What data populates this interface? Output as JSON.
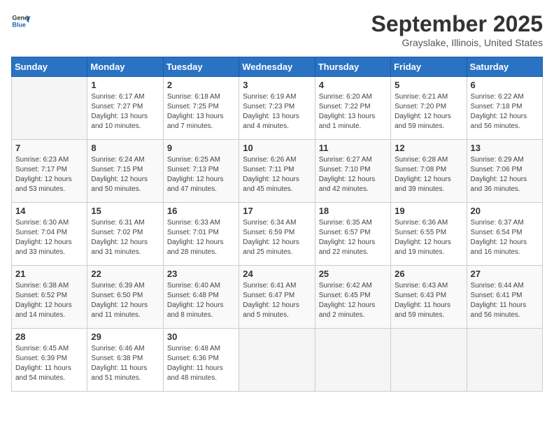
{
  "logo": {
    "line1": "General",
    "line2": "Blue"
  },
  "title": "September 2025",
  "location": "Grayslake, Illinois, United States",
  "days_of_week": [
    "Sunday",
    "Monday",
    "Tuesday",
    "Wednesday",
    "Thursday",
    "Friday",
    "Saturday"
  ],
  "weeks": [
    [
      null,
      {
        "day": "1",
        "sunrise": "6:17 AM",
        "sunset": "7:27 PM",
        "daylight": "13 hours and 10 minutes."
      },
      {
        "day": "2",
        "sunrise": "6:18 AM",
        "sunset": "7:25 PM",
        "daylight": "13 hours and 7 minutes."
      },
      {
        "day": "3",
        "sunrise": "6:19 AM",
        "sunset": "7:23 PM",
        "daylight": "13 hours and 4 minutes."
      },
      {
        "day": "4",
        "sunrise": "6:20 AM",
        "sunset": "7:22 PM",
        "daylight": "13 hours and 1 minute."
      },
      {
        "day": "5",
        "sunrise": "6:21 AM",
        "sunset": "7:20 PM",
        "daylight": "12 hours and 59 minutes."
      },
      {
        "day": "6",
        "sunrise": "6:22 AM",
        "sunset": "7:18 PM",
        "daylight": "12 hours and 56 minutes."
      }
    ],
    [
      {
        "day": "7",
        "sunrise": "6:23 AM",
        "sunset": "7:17 PM",
        "daylight": "12 hours and 53 minutes."
      },
      {
        "day": "8",
        "sunrise": "6:24 AM",
        "sunset": "7:15 PM",
        "daylight": "12 hours and 50 minutes."
      },
      {
        "day": "9",
        "sunrise": "6:25 AM",
        "sunset": "7:13 PM",
        "daylight": "12 hours and 47 minutes."
      },
      {
        "day": "10",
        "sunrise": "6:26 AM",
        "sunset": "7:11 PM",
        "daylight": "12 hours and 45 minutes."
      },
      {
        "day": "11",
        "sunrise": "6:27 AM",
        "sunset": "7:10 PM",
        "daylight": "12 hours and 42 minutes."
      },
      {
        "day": "12",
        "sunrise": "6:28 AM",
        "sunset": "7:08 PM",
        "daylight": "12 hours and 39 minutes."
      },
      {
        "day": "13",
        "sunrise": "6:29 AM",
        "sunset": "7:06 PM",
        "daylight": "12 hours and 36 minutes."
      }
    ],
    [
      {
        "day": "14",
        "sunrise": "6:30 AM",
        "sunset": "7:04 PM",
        "daylight": "12 hours and 33 minutes."
      },
      {
        "day": "15",
        "sunrise": "6:31 AM",
        "sunset": "7:02 PM",
        "daylight": "12 hours and 31 minutes."
      },
      {
        "day": "16",
        "sunrise": "6:33 AM",
        "sunset": "7:01 PM",
        "daylight": "12 hours and 28 minutes."
      },
      {
        "day": "17",
        "sunrise": "6:34 AM",
        "sunset": "6:59 PM",
        "daylight": "12 hours and 25 minutes."
      },
      {
        "day": "18",
        "sunrise": "6:35 AM",
        "sunset": "6:57 PM",
        "daylight": "12 hours and 22 minutes."
      },
      {
        "day": "19",
        "sunrise": "6:36 AM",
        "sunset": "6:55 PM",
        "daylight": "12 hours and 19 minutes."
      },
      {
        "day": "20",
        "sunrise": "6:37 AM",
        "sunset": "6:54 PM",
        "daylight": "12 hours and 16 minutes."
      }
    ],
    [
      {
        "day": "21",
        "sunrise": "6:38 AM",
        "sunset": "6:52 PM",
        "daylight": "12 hours and 14 minutes."
      },
      {
        "day": "22",
        "sunrise": "6:39 AM",
        "sunset": "6:50 PM",
        "daylight": "12 hours and 11 minutes."
      },
      {
        "day": "23",
        "sunrise": "6:40 AM",
        "sunset": "6:48 PM",
        "daylight": "12 hours and 8 minutes."
      },
      {
        "day": "24",
        "sunrise": "6:41 AM",
        "sunset": "6:47 PM",
        "daylight": "12 hours and 5 minutes."
      },
      {
        "day": "25",
        "sunrise": "6:42 AM",
        "sunset": "6:45 PM",
        "daylight": "12 hours and 2 minutes."
      },
      {
        "day": "26",
        "sunrise": "6:43 AM",
        "sunset": "6:43 PM",
        "daylight": "11 hours and 59 minutes."
      },
      {
        "day": "27",
        "sunrise": "6:44 AM",
        "sunset": "6:41 PM",
        "daylight": "11 hours and 56 minutes."
      }
    ],
    [
      {
        "day": "28",
        "sunrise": "6:45 AM",
        "sunset": "6:39 PM",
        "daylight": "11 hours and 54 minutes."
      },
      {
        "day": "29",
        "sunrise": "6:46 AM",
        "sunset": "6:38 PM",
        "daylight": "11 hours and 51 minutes."
      },
      {
        "day": "30",
        "sunrise": "6:48 AM",
        "sunset": "6:36 PM",
        "daylight": "11 hours and 48 minutes."
      },
      null,
      null,
      null,
      null
    ]
  ]
}
